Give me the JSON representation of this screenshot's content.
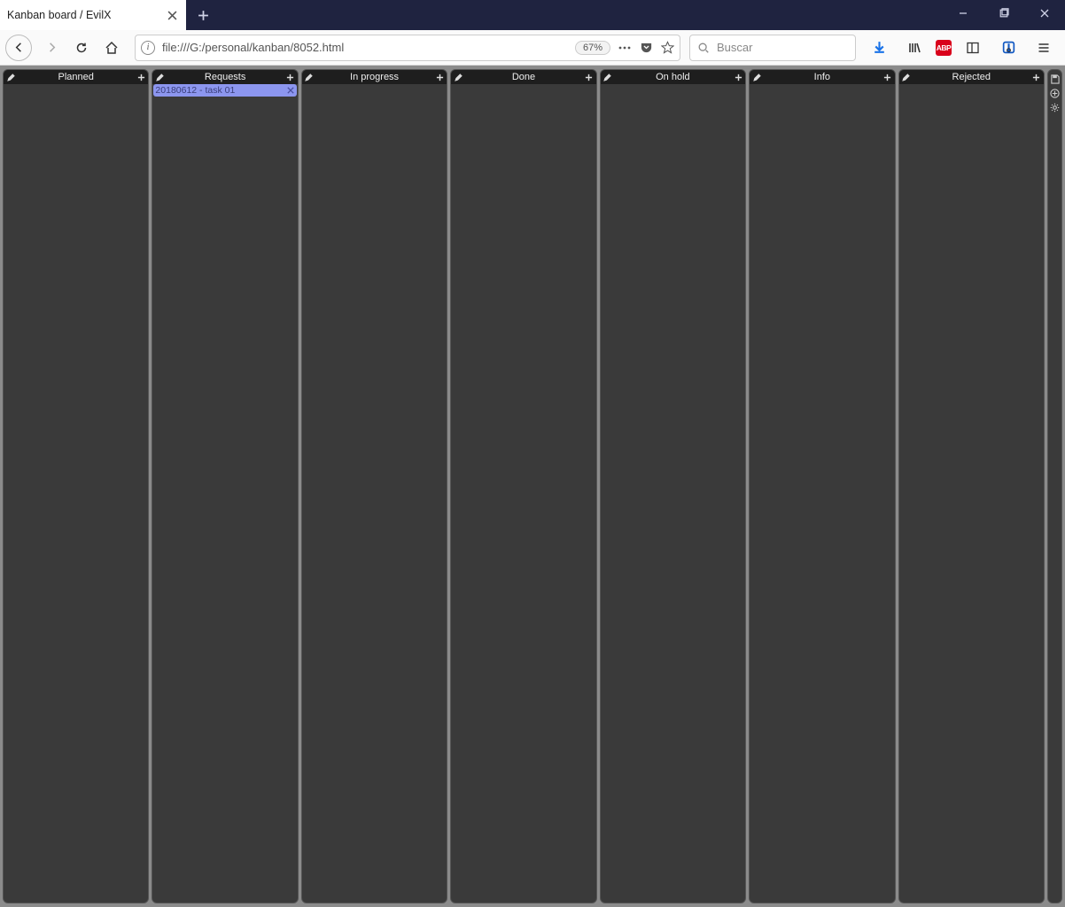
{
  "browser": {
    "tab_title": "Kanban board / EvilX",
    "url": "file:///G:/personal/kanban/8052.html",
    "zoom": "67%",
    "search_placeholder": "Buscar",
    "abp_label": "ABP"
  },
  "board": {
    "columns": [
      {
        "title": "Planned",
        "cards": []
      },
      {
        "title": "Requests",
        "cards": [
          {
            "text": "20180612 - task 01"
          }
        ]
      },
      {
        "title": "In progress",
        "cards": []
      },
      {
        "title": "Done",
        "cards": []
      },
      {
        "title": "On hold",
        "cards": []
      },
      {
        "title": "Info",
        "cards": []
      },
      {
        "title": "Rejected",
        "cards": []
      }
    ]
  }
}
